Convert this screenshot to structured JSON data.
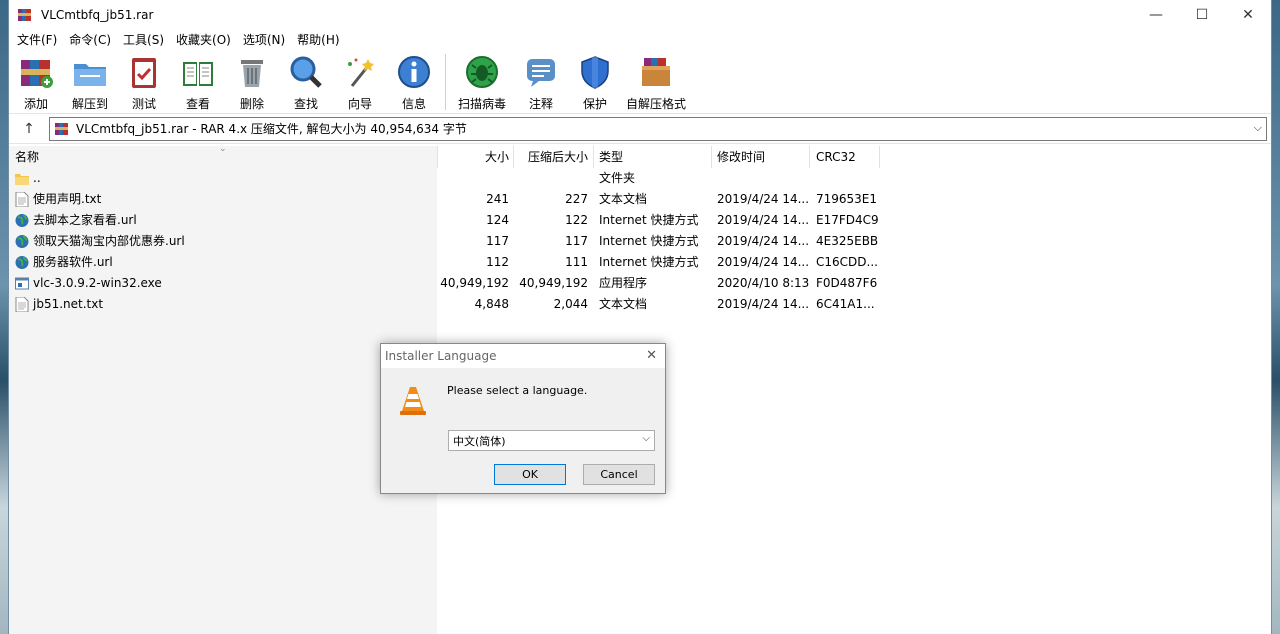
{
  "window": {
    "title": "VLCmtbfq_jb51.rar",
    "controls": {
      "minimize": "—",
      "maximize": "☐",
      "close": "✕"
    }
  },
  "menu": [
    "文件(F)",
    "命令(C)",
    "工具(S)",
    "收藏夹(O)",
    "选项(N)",
    "帮助(H)"
  ],
  "toolbar": [
    {
      "label": "添加",
      "icon": "add-archive-icon"
    },
    {
      "label": "解压到",
      "icon": "extract-folder-icon"
    },
    {
      "label": "测试",
      "icon": "test-clipboard-icon"
    },
    {
      "label": "查看",
      "icon": "view-book-icon"
    },
    {
      "label": "删除",
      "icon": "trash-icon"
    },
    {
      "label": "查找",
      "icon": "magnifier-icon"
    },
    {
      "label": "向导",
      "icon": "wizard-wand-icon"
    },
    {
      "label": "信息",
      "icon": "info-icon"
    },
    {
      "label": "扫描病毒",
      "icon": "virus-scan-icon"
    },
    {
      "label": "注释",
      "icon": "comment-icon"
    },
    {
      "label": "保护",
      "icon": "shield-icon"
    },
    {
      "label": "自解压格式",
      "icon": "sfx-box-icon"
    }
  ],
  "address": {
    "up": "↑",
    "text": "VLCmtbfq_jb51.rar - RAR 4.x 压缩文件, 解包大小为 40,954,634 字节",
    "dropdown": "⌵"
  },
  "columns": {
    "name": "名称",
    "size": "大小",
    "packed": "压缩后大小",
    "type": "类型",
    "modified": "修改时间",
    "crc": "CRC32",
    "sort_indicator": "⌄"
  },
  "files": [
    {
      "name": "..",
      "size": "",
      "packed": "",
      "type": "文件夹",
      "modified": "",
      "crc": "",
      "icon": "folder-icon"
    },
    {
      "name": "使用声明.txt",
      "size": "241",
      "packed": "227",
      "type": "文本文档",
      "modified": "2019/4/24 14...",
      "crc": "719653E1",
      "icon": "text-file-icon"
    },
    {
      "name": "去脚本之家看看.url",
      "size": "124",
      "packed": "122",
      "type": "Internet 快捷方式",
      "modified": "2019/4/24 14...",
      "crc": "E17FD4C9",
      "icon": "globe-icon"
    },
    {
      "name": "领取天猫淘宝内部优惠券.url",
      "size": "117",
      "packed": "117",
      "type": "Internet 快捷方式",
      "modified": "2019/4/24 14...",
      "crc": "4E325EBB",
      "icon": "globe-icon"
    },
    {
      "name": "服务器软件.url",
      "size": "112",
      "packed": "111",
      "type": "Internet 快捷方式",
      "modified": "2019/4/24 14...",
      "crc": "C16CDD...",
      "icon": "globe-icon"
    },
    {
      "name": "vlc-3.0.9.2-win32.exe",
      "size": "40,949,192",
      "packed": "40,949,192",
      "type": "应用程序",
      "modified": "2020/4/10 8:13",
      "crc": "F0D487F6",
      "icon": "exe-icon"
    },
    {
      "name": "jb51.net.txt",
      "size": "4,848",
      "packed": "2,044",
      "type": "文本文档",
      "modified": "2019/4/24 14...",
      "crc": "6C41A1...",
      "icon": "text-file-icon"
    }
  ],
  "dialog": {
    "title": "Installer Language",
    "close": "✕",
    "message": "Please select a language.",
    "selected_language": "中文(简体)",
    "chevron": "⌵",
    "ok": "OK",
    "cancel": "Cancel",
    "icon": "vlc-cone-icon"
  }
}
